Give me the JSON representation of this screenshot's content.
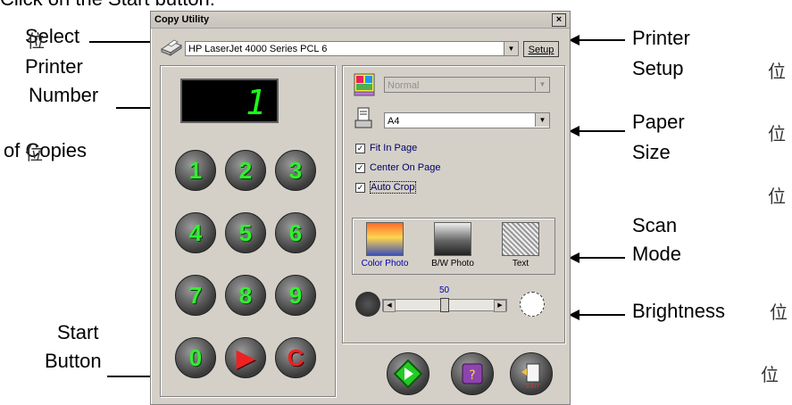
{
  "top_text": "Click on the Start button:",
  "annotations": {
    "select_printer": [
      "Select",
      "Printer"
    ],
    "number_of_copies": [
      "Number",
      "of Copies"
    ],
    "start_button": [
      "Start",
      "Button"
    ],
    "printer_setup": [
      "Printer",
      "Setup"
    ],
    "paper_size": [
      "Paper",
      "Size"
    ],
    "scan_mode": [
      "Scan",
      "Mode"
    ],
    "brightness": "Brightness",
    "cjk_mark": "位"
  },
  "window": {
    "title": "Copy Utility",
    "close_label": "×",
    "printer": "HP LaserJet 4000 Series PCL 6",
    "setup_label": "Setup",
    "copies_display": "1",
    "keypad": [
      "1",
      "2",
      "3",
      "4",
      "5",
      "6",
      "7",
      "8",
      "9",
      "0",
      "▶",
      "C"
    ],
    "color_mode": "Normal",
    "paper_size": "A4",
    "checkboxes": [
      {
        "label": "Fit In Page",
        "checked": true
      },
      {
        "label": "Center On Page",
        "checked": true
      },
      {
        "label": "Auto Crop",
        "checked": true
      }
    ],
    "scan_modes": [
      {
        "label": "Color Photo",
        "selected": true
      },
      {
        "label": "B/W Photo",
        "selected": false
      },
      {
        "label": "Text",
        "selected": false
      }
    ],
    "brightness_value": "50"
  },
  "colors": {
    "digit_green": "#33ee33",
    "key_red": "#ee2222",
    "window_bg": "#d4d0c8"
  }
}
